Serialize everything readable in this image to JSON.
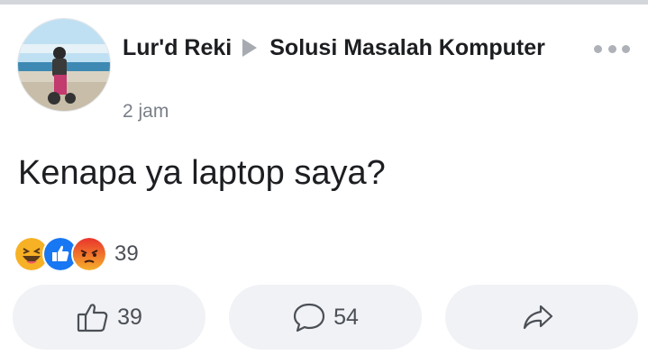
{
  "post": {
    "author": "Lur'd Reki",
    "group": "Solusi Masalah Komputer",
    "time": "2 jam",
    "text": "Kenapa ya laptop saya?"
  },
  "reactions": {
    "types": [
      "haha",
      "like",
      "angry"
    ],
    "count": "39"
  },
  "actions": {
    "like_count": "39",
    "comment_count": "54"
  },
  "icons": {
    "more": "more-horizontal-icon",
    "like": "thumbs-up-outline-icon",
    "comment": "speech-bubble-icon",
    "share": "share-arrow-icon"
  },
  "colors": {
    "haha": "#f7b125",
    "like": "#1877f2",
    "angry": "#e9710f",
    "button_bg": "#f0f2f5",
    "text_muted": "#7a7f87"
  }
}
